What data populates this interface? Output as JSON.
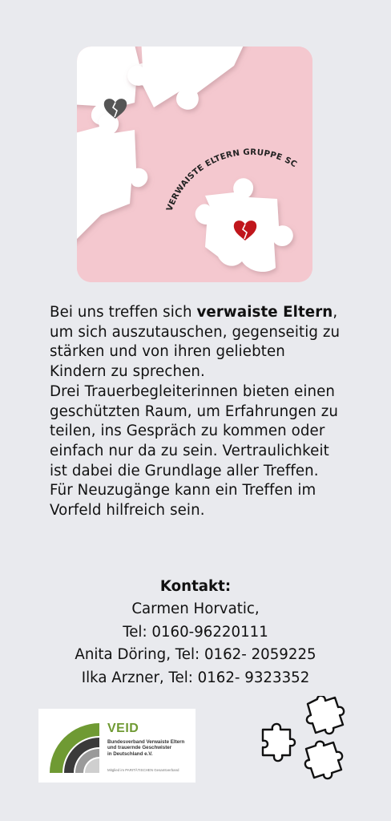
{
  "hero": {
    "curved_title": "VERWAISTE ELTERN GRUPPE SCHOPFHEIM",
    "colors": {
      "background": "#f4c8cf",
      "piece": "#ffffff",
      "heart_gray": "#555555",
      "heart_red": "#c0161c"
    },
    "icons": [
      "puzzle-piece-icon",
      "broken-heart-icon"
    ]
  },
  "intro": {
    "part1": "Bei uns treffen sich ",
    "bold": "verwaiste Eltern",
    "part2": ", um sich auszutauschen, gegenseitig zu stärken und von ihren geliebten Kindern zu sprechen.",
    "part3": "Drei Trauerbegleiterinnen bieten einen geschützten Raum, um Erfahrungen zu teilen, ins Gespräch zu kommen oder einfach nur da zu sein. Vertraulichkeit ist dabei die Grundlage aller Treffen. Für Neuzugänge kann ein Treffen im Vorfeld hilfreich sein."
  },
  "contact": {
    "heading": "Kontakt:",
    "lines": [
      "Carmen Horvatic,",
      "Tel: 0160-96220111",
      "Anita Döring, Tel: 0162- 2059225",
      "Ilka Arzner, Tel:  0162- 9323352"
    ]
  },
  "logo": {
    "name": "VEID",
    "org_lines": [
      "Bundesverband Verwaiste Eltern",
      "und trauernde Geschwister",
      "in Deutschland e.V."
    ],
    "member": "Mitglied im PARITÄTISCHEN Gesamtverband",
    "colors": {
      "green": "#6f9a33",
      "dark": "#3a3a3a",
      "gray": "#9a9a9a"
    }
  },
  "decoration": {
    "icon": "puzzle-pieces-outline-icon",
    "color": "#111111"
  }
}
